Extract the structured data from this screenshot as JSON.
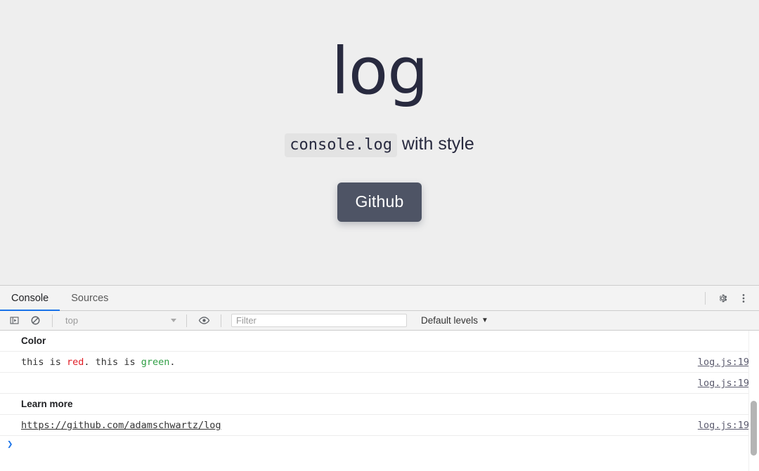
{
  "page": {
    "logo": "log",
    "tagline_code": "console.log",
    "tagline_rest": " with style",
    "github_button": "Github",
    "bg_color": "#eeeeee",
    "logo_color": "#282a3f",
    "button_color": "#4e5465"
  },
  "devtools": {
    "tabs": [
      {
        "label": "Console",
        "active": true
      },
      {
        "label": "Sources",
        "active": false
      }
    ],
    "tabbar_icons": [
      {
        "name": "gear-icon"
      },
      {
        "name": "more-vertical-icon"
      }
    ],
    "toolbar": {
      "sidebar_toggle_icon": "console-sidebar-icon",
      "clear_icon": "clear-console-icon",
      "context_value": "top",
      "eye_icon": "live-expression-icon",
      "filter_placeholder": "Filter",
      "filter_value": "",
      "levels_label": "Default levels",
      "levels_caret": "▼"
    },
    "messages": [
      {
        "kind": "group-header",
        "text": "Color",
        "source": ""
      },
      {
        "kind": "colored",
        "segments": [
          {
            "text": "this is ",
            "color": "default"
          },
          {
            "text": "red",
            "color": "red"
          },
          {
            "text": ". this is ",
            "color": "default"
          },
          {
            "text": "green",
            "color": "green"
          },
          {
            "text": ".",
            "color": "default"
          }
        ],
        "source": "log.js:19"
      },
      {
        "kind": "blank",
        "text": "",
        "source": "log.js:19"
      },
      {
        "kind": "group-header",
        "text": "Learn more",
        "source": ""
      },
      {
        "kind": "link",
        "text": "https://github.com/adamschwartz/log",
        "source": "log.js:19"
      }
    ],
    "prompt": {
      "caret": "❯",
      "value": ""
    },
    "colors": {
      "accent": "#1a73e8",
      "red": "#e01b24",
      "green": "#2f9e44"
    }
  }
}
